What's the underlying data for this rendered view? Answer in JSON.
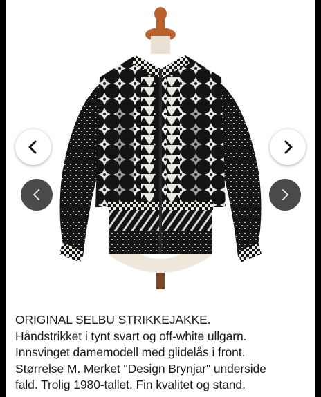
{
  "carousel": {
    "prev_icon": "chevron-left-icon",
    "next_icon": "chevron-right-icon",
    "colors": {
      "button_light": "#ffffff",
      "button_dark": "#4a4a4a",
      "garment_black": "#141414",
      "garment_white": "#e9e9e4"
    }
  },
  "description": {
    "lines": [
      "ORIGINAL SELBU STRIKKEJAKKE.",
      "Håndstrikket i tynt svart og off-white ullgarn.",
      "Innsvinget damemodell med glidelås i front.",
      "Størrelse M. Merket \"Design Brynjar\" underside",
      "fald. Trolig 1980-tallet. Fin kvalitet og stand."
    ]
  }
}
